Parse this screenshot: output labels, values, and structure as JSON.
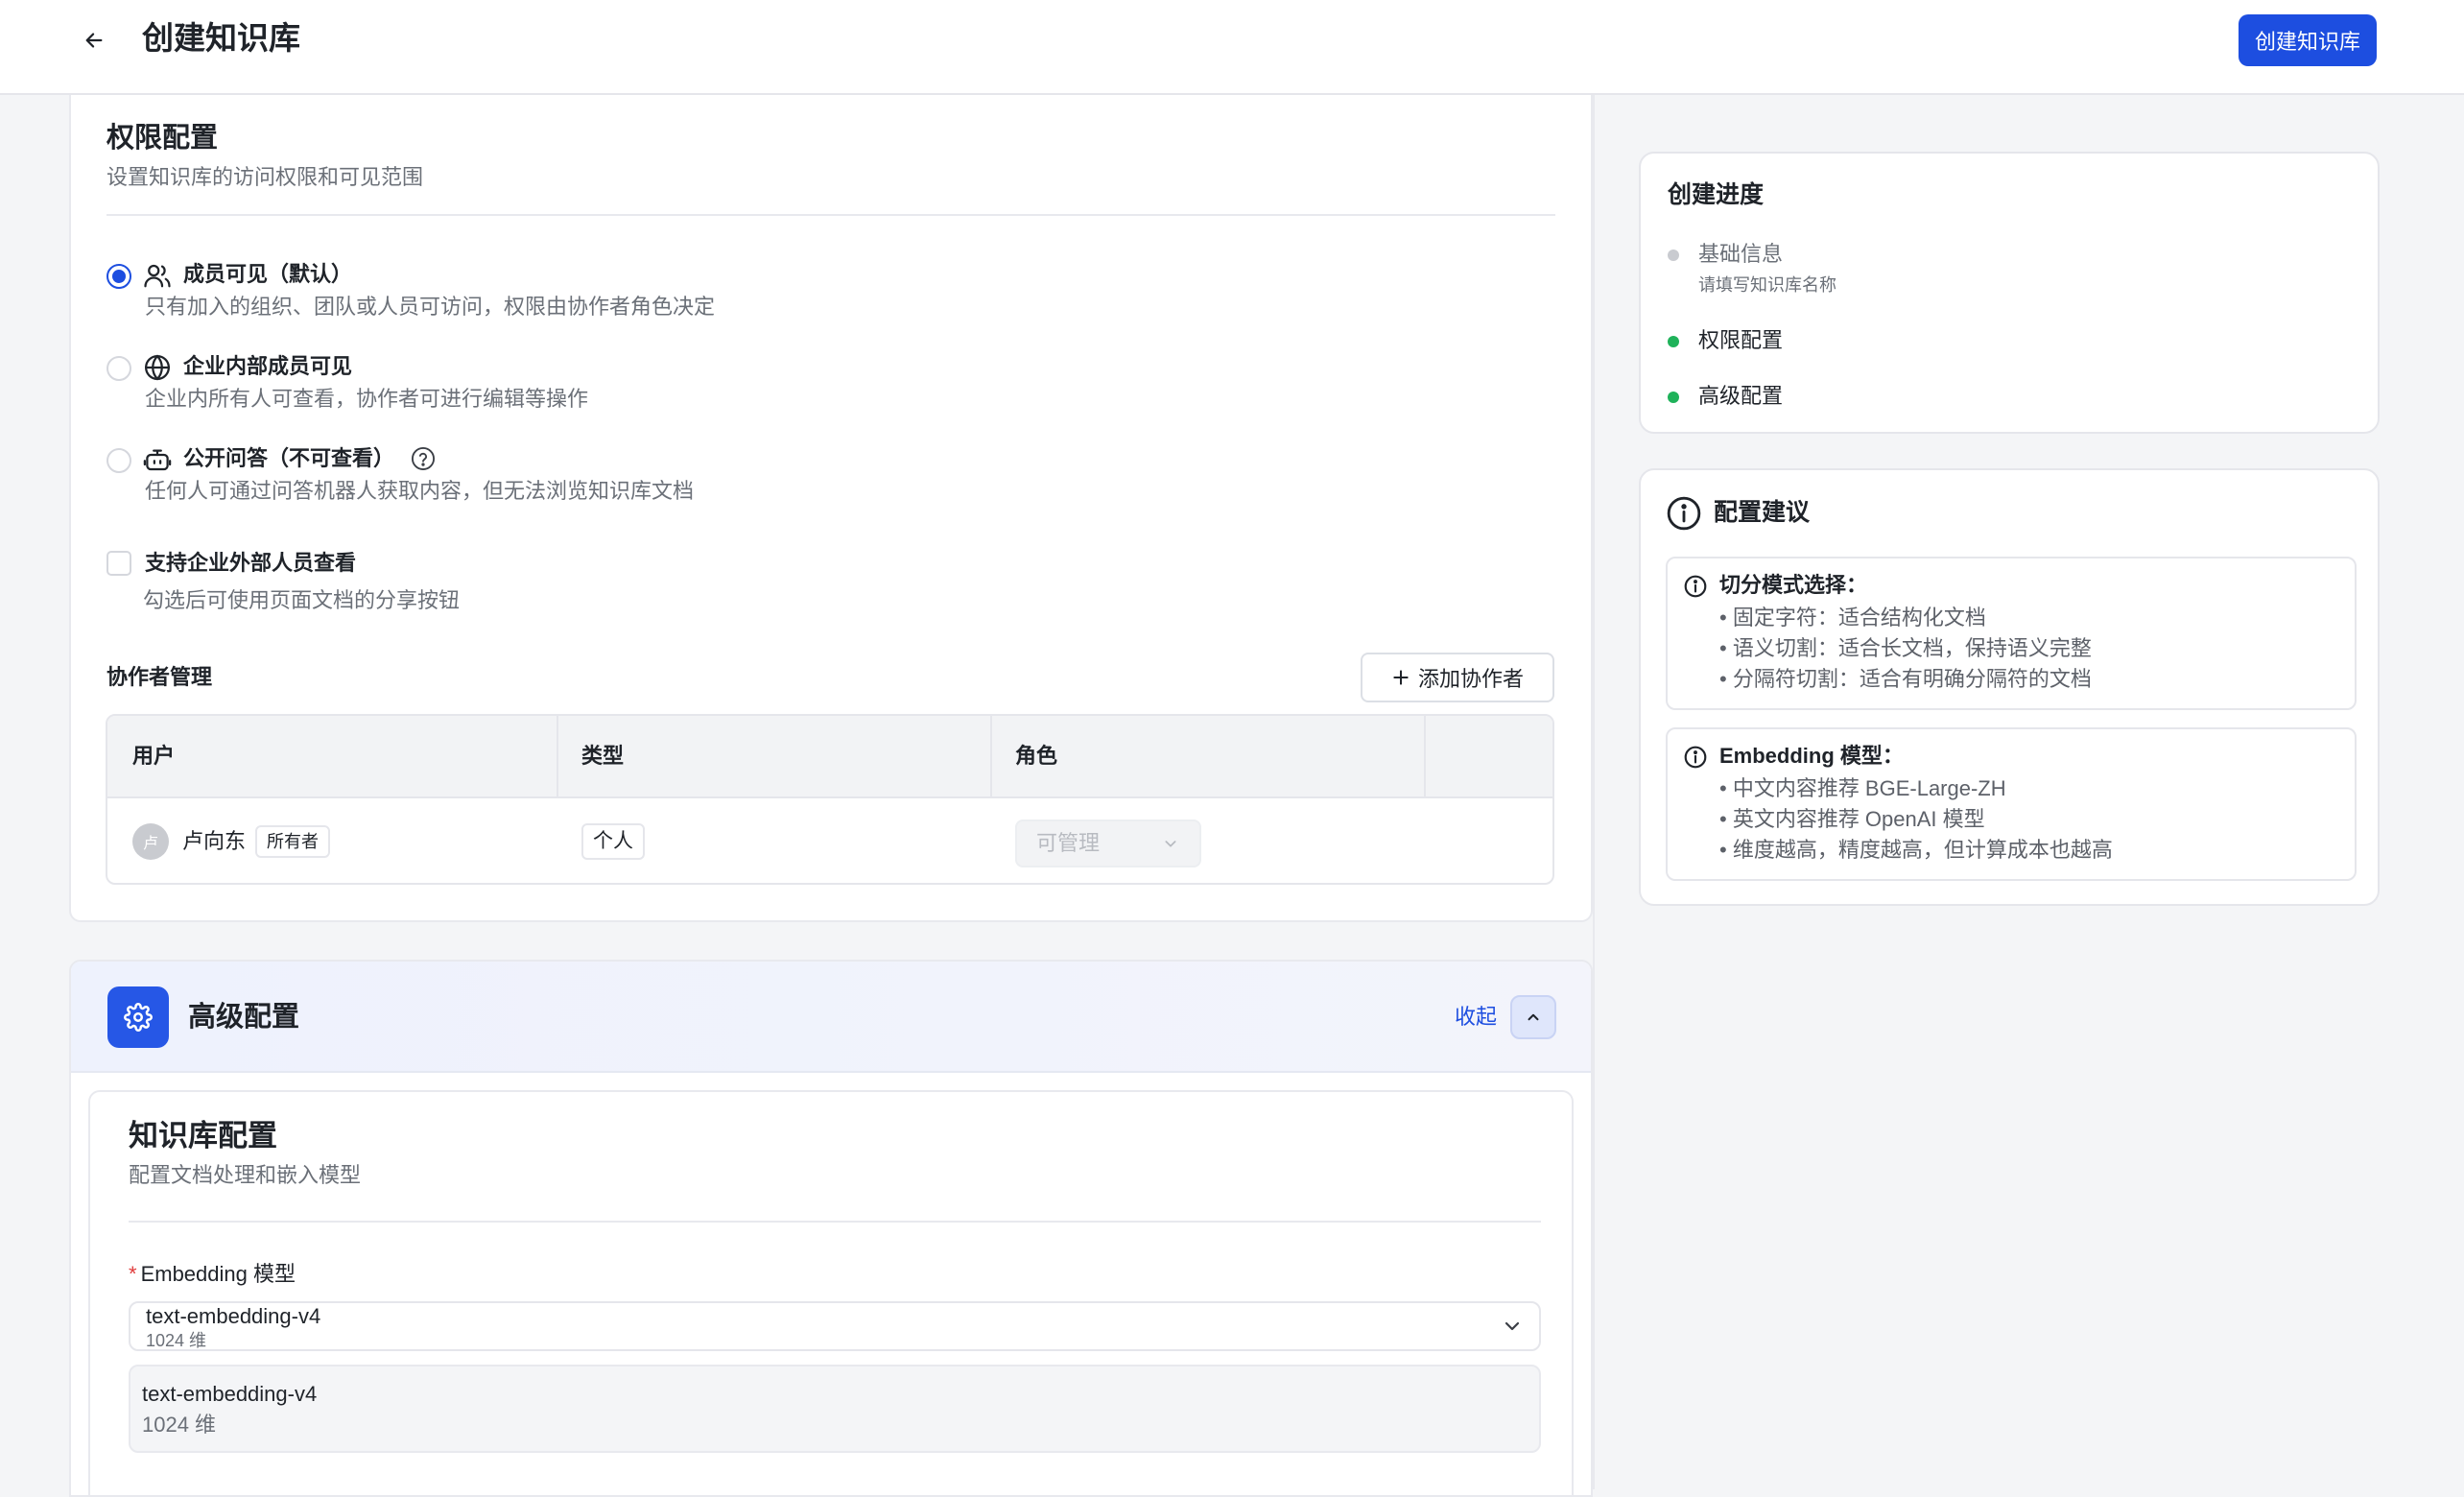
{
  "header": {
    "title": "创建知识库",
    "primary_button": "创建知识库"
  },
  "permissions": {
    "title": "权限配置",
    "description": "设置知识库的访问权限和可见范围",
    "options": [
      {
        "label": "成员可见（默认）",
        "description": "只有加入的组织、团队或人员可访问，权限由协作者角色决定",
        "icon": "users-icon",
        "checked": true
      },
      {
        "label": "企业内部成员可见",
        "description": "企业内所有人可查看，协作者可进行编辑等操作",
        "icon": "globe-icon",
        "checked": false
      },
      {
        "label": "公开问答（不可查看）",
        "description": "任何人可通过问答机器人获取内容，但无法浏览知识库文档",
        "icon": "bot-icon",
        "checked": false
      }
    ],
    "external_checkbox": {
      "label": "支持企业外部人员查看",
      "description": "勾选后可使用页面文档的分享按钮",
      "checked": false
    }
  },
  "collaborators": {
    "title": "协作者管理",
    "add_button": "添加协作者",
    "columns": [
      "用户",
      "类型",
      "角色"
    ],
    "rows": [
      {
        "avatar": "卢",
        "name": "卢向东",
        "badge": "所有者",
        "type": "个人",
        "role": "可管理"
      }
    ]
  },
  "advanced": {
    "title": "高级配置",
    "collapse_label": "收起",
    "kb_config": {
      "title": "知识库配置",
      "description": "配置文档处理和嵌入模型",
      "embedding_label": "Embedding 模型",
      "selected": {
        "name": "text-embedding-v4",
        "dim": "1024 维"
      },
      "option": {
        "name": "text-embedding-v4",
        "dim": "1024 维"
      }
    }
  },
  "progress": {
    "title": "创建进度",
    "steps": [
      {
        "label": "基础信息",
        "sub": "请填写知识库名称",
        "status": "pending",
        "color": "#c9cbd0"
      },
      {
        "label": "权限配置",
        "sub": "",
        "status": "done",
        "color": "#1fb25a"
      },
      {
        "label": "高级配置",
        "sub": "",
        "status": "done",
        "color": "#1fb25a"
      }
    ]
  },
  "tips": {
    "title": "配置建议",
    "groups": [
      {
        "heading": "切分模式选择：",
        "items": [
          "• 固定字符：适合结构化文档",
          "• 语义切割：适合长文档，保持语义完整",
          "• 分隔符切割：适合有明确分隔符的文档"
        ]
      },
      {
        "heading": "Embedding 模型：",
        "items": [
          "• 中文内容推荐 BGE-Large-ZH",
          "• 英文内容推荐 OpenAI 模型",
          "• 维度越高，精度越高，但计算成本也越高"
        ]
      }
    ]
  },
  "colors": {
    "accent": "#1d4ee0",
    "success": "#1fb25a",
    "required": "#e03c3c"
  }
}
